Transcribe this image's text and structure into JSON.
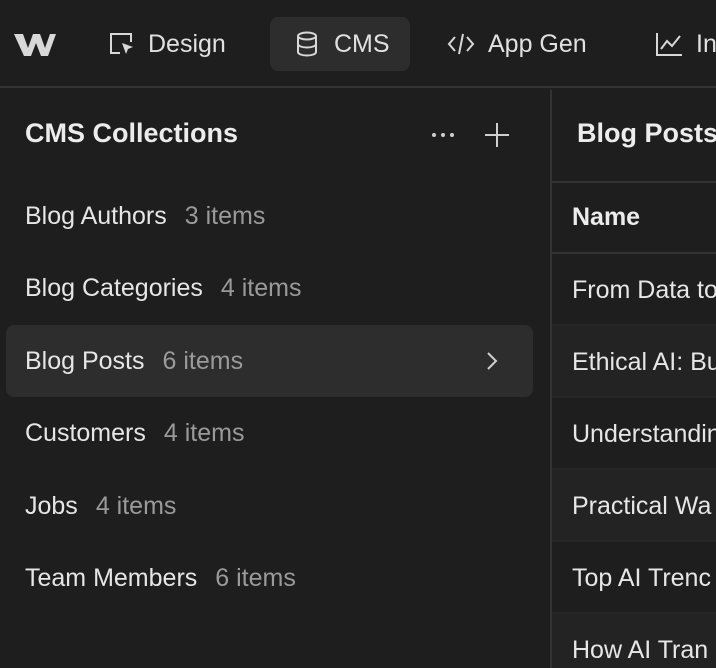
{
  "nav": {
    "tabs": [
      {
        "label": "Design",
        "icon": "cursor-box-icon"
      },
      {
        "label": "CMS",
        "icon": "database-icon"
      },
      {
        "label": "App Gen",
        "icon": "code-icon"
      },
      {
        "label": "In",
        "icon": "chart-icon"
      }
    ]
  },
  "sidebar": {
    "title": "CMS Collections",
    "collections": [
      {
        "name": "Blog Authors",
        "count": "3 items"
      },
      {
        "name": "Blog Categories",
        "count": "4 items"
      },
      {
        "name": "Blog Posts",
        "count": "6 items"
      },
      {
        "name": "Customers",
        "count": "4 items"
      },
      {
        "name": "Jobs",
        "count": "4 items"
      },
      {
        "name": "Team Members",
        "count": "6 items"
      }
    ]
  },
  "main": {
    "title": "Blog Posts",
    "column_header": "Name",
    "rows": [
      "From Data to",
      "Ethical AI: Bu",
      "Understandin",
      "Practical Wa",
      "Top AI Trenc",
      "How AI Tran"
    ]
  },
  "colors": {
    "background": "#1e1e1e",
    "active": "#2d2d2d",
    "muted_text": "#9a9a9a"
  }
}
